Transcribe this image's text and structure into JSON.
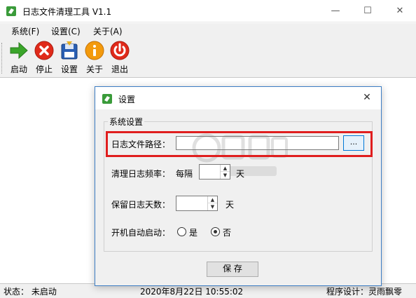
{
  "window": {
    "title": "日志文件清理工具 V1.1",
    "minimize_glyph": "—",
    "maximize_glyph": "☐",
    "close_glyph": "✕"
  },
  "menu": {
    "items": [
      {
        "label": "系统(F)"
      },
      {
        "label": "设置(C)"
      },
      {
        "label": "关于(A)"
      }
    ]
  },
  "toolbar": {
    "buttons": [
      {
        "label": "启动",
        "icon": "start-arrow-icon",
        "color": "#3aa52a"
      },
      {
        "label": "停止",
        "icon": "stop-icon",
        "color": "#e02a1a"
      },
      {
        "label": "设置",
        "icon": "settings-save-icon",
        "color": "#2a5fb3"
      },
      {
        "label": "关于",
        "icon": "info-icon",
        "color": "#f39a0d"
      },
      {
        "label": "退出",
        "icon": "power-icon",
        "color": "#e02a1a"
      }
    ]
  },
  "status": {
    "state": "状态：  未启动",
    "datetime": "2020年8月22日   10:55:02",
    "designer": "程序设计：灵雨飘零"
  },
  "dialog": {
    "title": "设置",
    "close_glyph": "✕",
    "group_title": "系统设置",
    "log_path": {
      "label": "日志文件路径：",
      "value": "",
      "browse_label": "..."
    },
    "clean_frequency": {
      "label": "清理日志频率：",
      "prefix": "每隔",
      "value": "",
      "unit": "天"
    },
    "keep_days": {
      "label": "保留日志天数：",
      "value": "",
      "unit": "天"
    },
    "autostart": {
      "label": "开机自动启动：",
      "options": [
        {
          "label": "是",
          "selected": false
        },
        {
          "label": "否",
          "selected": true
        }
      ]
    },
    "save_label": "保 存"
  },
  "colors": {
    "highlight_border": "#e01e1e",
    "dialog_border": "#3c7dc4",
    "app_icon_green": "#3a9b3a"
  }
}
